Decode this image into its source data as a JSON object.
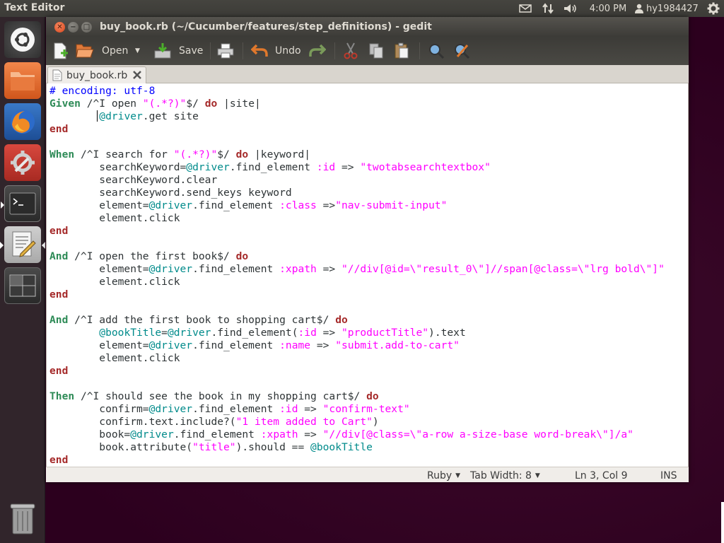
{
  "top_panel": {
    "app_title": "Text Editor",
    "clock": "4:00 PM",
    "username": "hy1984427",
    "indicators": [
      "mail-icon",
      "network-icon",
      "volume-icon",
      "user-icon",
      "gear-icon"
    ]
  },
  "launcher": {
    "items": [
      {
        "name": "ubuntu-dash-icon"
      },
      {
        "name": "files-icon"
      },
      {
        "name": "firefox-icon"
      },
      {
        "name": "system-settings-icon"
      },
      {
        "name": "terminal-icon"
      },
      {
        "name": "text-editor-icon"
      },
      {
        "name": "workspace-switcher-icon"
      },
      {
        "name": "trash-icon"
      }
    ]
  },
  "window": {
    "title": "buy_book.rb (~/Cucumber/features/step_definitions) - gedit"
  },
  "toolbar": {
    "open_label": "Open",
    "save_label": "Save",
    "undo_label": "Undo"
  },
  "tab": {
    "label": "buy_book.rb"
  },
  "code_lines": [
    "# encoding: utf-8",
    "Given /^I open \"(.*?)\"$/ do |site|",
    "        @driver.get site",
    "end",
    "",
    "When /^I search for \"(.*?)\"$/ do |keyword|",
    "        searchKeyword=@driver.find_element :id => \"twotabsearchtextbox\"",
    "        searchKeyword.clear",
    "        searchKeyword.send_keys keyword",
    "        element=@driver.find_element :class =>\"nav-submit-input\"",
    "        element.click",
    "end",
    "",
    "And /^I open the first book$/ do",
    "        element=@driver.find_element :xpath => \"//div[@id=\\\"result_0\\\"]//span[@class=\\\"lrg bold\\\"]\"",
    "        element.click",
    "end",
    "",
    "And /^I add the first book to shopping cart$/ do",
    "        @bookTitle=@driver.find_element(:id => \"productTitle\").text",
    "        element=@driver.find_element :name => \"submit.add-to-cart\"",
    "        element.click",
    "end",
    "",
    "Then /^I should see the book in my shopping cart$/ do",
    "        confirm=@driver.find_element :id => \"confirm-text\"",
    "        confirm.text.include?(\"1 item added to Cart\")",
    "        book=@driver.find_element :xpath => \"//div[@class=\\\"a-row a-size-base word-break\\\"]/a\"",
    "        book.attribute(\"title\").should == @bookTitle",
    "end"
  ],
  "statusbar": {
    "language": "Ruby",
    "tab_width": "Tab Width: 8",
    "position": "Ln 3, Col 9",
    "mode": "INS"
  },
  "colors": {
    "desktop": "#2c001e",
    "panel": "#3c3b37",
    "keyword_step": "#2e8b57",
    "keyword_block": "#a52a2a",
    "string": "#ff00ff",
    "instance_var": "#008b8b",
    "comment": "#0000ff"
  }
}
